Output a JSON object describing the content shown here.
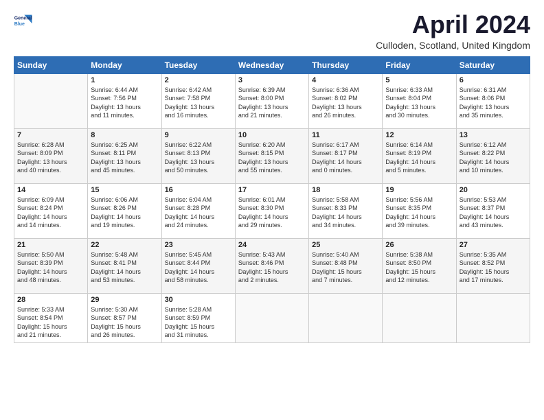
{
  "header": {
    "logo_general": "General",
    "logo_blue": "Blue",
    "month_title": "April 2024",
    "location": "Culloden, Scotland, United Kingdom"
  },
  "days_of_week": [
    "Sunday",
    "Monday",
    "Tuesday",
    "Wednesday",
    "Thursday",
    "Friday",
    "Saturday"
  ],
  "weeks": [
    [
      {
        "day": "",
        "empty": true
      },
      {
        "day": "1",
        "sunrise": "Sunrise: 6:44 AM",
        "sunset": "Sunset: 7:56 PM",
        "daylight": "Daylight: 13 hours and 11 minutes."
      },
      {
        "day": "2",
        "sunrise": "Sunrise: 6:42 AM",
        "sunset": "Sunset: 7:58 PM",
        "daylight": "Daylight: 13 hours and 16 minutes."
      },
      {
        "day": "3",
        "sunrise": "Sunrise: 6:39 AM",
        "sunset": "Sunset: 8:00 PM",
        "daylight": "Daylight: 13 hours and 21 minutes."
      },
      {
        "day": "4",
        "sunrise": "Sunrise: 6:36 AM",
        "sunset": "Sunset: 8:02 PM",
        "daylight": "Daylight: 13 hours and 26 minutes."
      },
      {
        "day": "5",
        "sunrise": "Sunrise: 6:33 AM",
        "sunset": "Sunset: 8:04 PM",
        "daylight": "Daylight: 13 hours and 30 minutes."
      },
      {
        "day": "6",
        "sunrise": "Sunrise: 6:31 AM",
        "sunset": "Sunset: 8:06 PM",
        "daylight": "Daylight: 13 hours and 35 minutes."
      }
    ],
    [
      {
        "day": "7",
        "sunrise": "Sunrise: 6:28 AM",
        "sunset": "Sunset: 8:09 PM",
        "daylight": "Daylight: 13 hours and 40 minutes."
      },
      {
        "day": "8",
        "sunrise": "Sunrise: 6:25 AM",
        "sunset": "Sunset: 8:11 PM",
        "daylight": "Daylight: 13 hours and 45 minutes."
      },
      {
        "day": "9",
        "sunrise": "Sunrise: 6:22 AM",
        "sunset": "Sunset: 8:13 PM",
        "daylight": "Daylight: 13 hours and 50 minutes."
      },
      {
        "day": "10",
        "sunrise": "Sunrise: 6:20 AM",
        "sunset": "Sunset: 8:15 PM",
        "daylight": "Daylight: 13 hours and 55 minutes."
      },
      {
        "day": "11",
        "sunrise": "Sunrise: 6:17 AM",
        "sunset": "Sunset: 8:17 PM",
        "daylight": "Daylight: 14 hours and 0 minutes."
      },
      {
        "day": "12",
        "sunrise": "Sunrise: 6:14 AM",
        "sunset": "Sunset: 8:19 PM",
        "daylight": "Daylight: 14 hours and 5 minutes."
      },
      {
        "day": "13",
        "sunrise": "Sunrise: 6:12 AM",
        "sunset": "Sunset: 8:22 PM",
        "daylight": "Daylight: 14 hours and 10 minutes."
      }
    ],
    [
      {
        "day": "14",
        "sunrise": "Sunrise: 6:09 AM",
        "sunset": "Sunset: 8:24 PM",
        "daylight": "Daylight: 14 hours and 14 minutes."
      },
      {
        "day": "15",
        "sunrise": "Sunrise: 6:06 AM",
        "sunset": "Sunset: 8:26 PM",
        "daylight": "Daylight: 14 hours and 19 minutes."
      },
      {
        "day": "16",
        "sunrise": "Sunrise: 6:04 AM",
        "sunset": "Sunset: 8:28 PM",
        "daylight": "Daylight: 14 hours and 24 minutes."
      },
      {
        "day": "17",
        "sunrise": "Sunrise: 6:01 AM",
        "sunset": "Sunset: 8:30 PM",
        "daylight": "Daylight: 14 hours and 29 minutes."
      },
      {
        "day": "18",
        "sunrise": "Sunrise: 5:58 AM",
        "sunset": "Sunset: 8:33 PM",
        "daylight": "Daylight: 14 hours and 34 minutes."
      },
      {
        "day": "19",
        "sunrise": "Sunrise: 5:56 AM",
        "sunset": "Sunset: 8:35 PM",
        "daylight": "Daylight: 14 hours and 39 minutes."
      },
      {
        "day": "20",
        "sunrise": "Sunrise: 5:53 AM",
        "sunset": "Sunset: 8:37 PM",
        "daylight": "Daylight: 14 hours and 43 minutes."
      }
    ],
    [
      {
        "day": "21",
        "sunrise": "Sunrise: 5:50 AM",
        "sunset": "Sunset: 8:39 PM",
        "daylight": "Daylight: 14 hours and 48 minutes."
      },
      {
        "day": "22",
        "sunrise": "Sunrise: 5:48 AM",
        "sunset": "Sunset: 8:41 PM",
        "daylight": "Daylight: 14 hours and 53 minutes."
      },
      {
        "day": "23",
        "sunrise": "Sunrise: 5:45 AM",
        "sunset": "Sunset: 8:44 PM",
        "daylight": "Daylight: 14 hours and 58 minutes."
      },
      {
        "day": "24",
        "sunrise": "Sunrise: 5:43 AM",
        "sunset": "Sunset: 8:46 PM",
        "daylight": "Daylight: 15 hours and 2 minutes."
      },
      {
        "day": "25",
        "sunrise": "Sunrise: 5:40 AM",
        "sunset": "Sunset: 8:48 PM",
        "daylight": "Daylight: 15 hours and 7 minutes."
      },
      {
        "day": "26",
        "sunrise": "Sunrise: 5:38 AM",
        "sunset": "Sunset: 8:50 PM",
        "daylight": "Daylight: 15 hours and 12 minutes."
      },
      {
        "day": "27",
        "sunrise": "Sunrise: 5:35 AM",
        "sunset": "Sunset: 8:52 PM",
        "daylight": "Daylight: 15 hours and 17 minutes."
      }
    ],
    [
      {
        "day": "28",
        "sunrise": "Sunrise: 5:33 AM",
        "sunset": "Sunset: 8:54 PM",
        "daylight": "Daylight: 15 hours and 21 minutes."
      },
      {
        "day": "29",
        "sunrise": "Sunrise: 5:30 AM",
        "sunset": "Sunset: 8:57 PM",
        "daylight": "Daylight: 15 hours and 26 minutes."
      },
      {
        "day": "30",
        "sunrise": "Sunrise: 5:28 AM",
        "sunset": "Sunset: 8:59 PM",
        "daylight": "Daylight: 15 hours and 31 minutes."
      },
      {
        "day": "",
        "empty": true
      },
      {
        "day": "",
        "empty": true
      },
      {
        "day": "",
        "empty": true
      },
      {
        "day": "",
        "empty": true
      }
    ]
  ]
}
